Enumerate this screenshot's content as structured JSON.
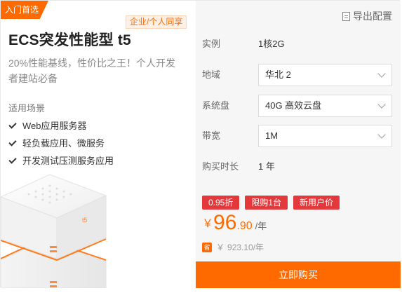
{
  "left": {
    "ribbon": "入门首选",
    "share_badge": "企业/个人同享",
    "title": "ECS突发性能型 t5",
    "description": "20%性能基线，性价比之王！个人开发者建站必备",
    "scene_heading": "适用场景",
    "scenes": [
      "Web应用服务器",
      "轻负载应用、微服务",
      "开发测试压测服务应用"
    ],
    "illustration_label": "t5"
  },
  "right": {
    "export_label": "导出配置",
    "specs": {
      "instance": {
        "label": "实例",
        "value": "1核2G"
      },
      "region": {
        "label": "地域",
        "value": "华北 2"
      },
      "disk": {
        "label": "系统盘",
        "value": "40G 高效云盘"
      },
      "bandwidth": {
        "label": "带宽",
        "value": "1M"
      },
      "duration": {
        "label": "购买时长",
        "value": "1 年"
      }
    },
    "tags": [
      "0.95折",
      "限购1台",
      "新用户价"
    ],
    "price": {
      "currency": "￥",
      "integer": "96",
      "decimal": ".90",
      "unit": "/年"
    },
    "original": {
      "icon": "省",
      "currency": "￥",
      "value": "923.10",
      "unit": "/年"
    },
    "buy_label": "立即购买"
  },
  "colors": {
    "accent": "#ff6a00",
    "tag": "#e4393c",
    "panel": "#f6f6f6"
  },
  "icons": [
    "check-icon",
    "document-icon",
    "chevron-down-icon",
    "save-icon"
  ]
}
